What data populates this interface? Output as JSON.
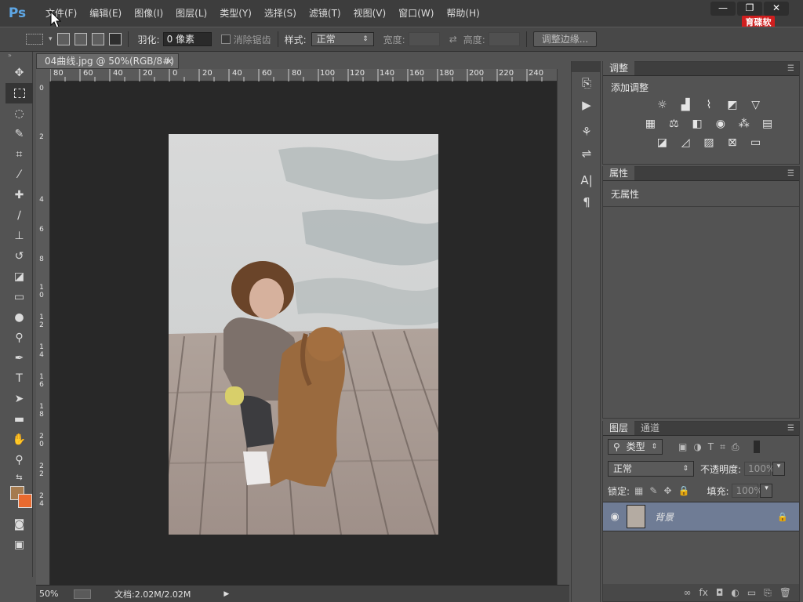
{
  "app": {
    "logo": "Ps",
    "brand": "育碟软件"
  },
  "menubar": {
    "items": [
      "文件(F)",
      "编辑(E)",
      "图像(I)",
      "图层(L)",
      "类型(Y)",
      "选择(S)",
      "滤镜(T)",
      "视图(V)",
      "窗口(W)",
      "帮助(H)"
    ]
  },
  "window_controls": {
    "minimize": "—",
    "restore": "❐",
    "close": "✕"
  },
  "options": {
    "feather_label": "羽化:",
    "feather_value": "0 像素",
    "antialias_label": "消除锯齿",
    "style_label": "样式:",
    "style_value": "正常",
    "width_label": "宽度:",
    "height_label": "高度:",
    "refine_edge": "调整边缘..."
  },
  "document": {
    "tab_title": "04曲线.jpg @ 50%(RGB/8#)",
    "tab_close": "×",
    "ruler_h": [
      "80",
      "60",
      "40",
      "20",
      "0",
      "20",
      "40",
      "60",
      "80",
      "100",
      "120",
      "140",
      "160",
      "180",
      "200",
      "220",
      "240"
    ],
    "ruler_v": [
      "0",
      "2",
      "4",
      "6",
      "8",
      "1\n0",
      "1\n2",
      "1\n4",
      "1\n6",
      "1\n8",
      "2\n0",
      "2\n2",
      "2\n4"
    ]
  },
  "status": {
    "zoom": "50%",
    "doc": "文档:2.02M/2.02M"
  },
  "panels": {
    "adjustments": {
      "tab": "调整",
      "title": "添加调整"
    },
    "properties": {
      "tab": "属性",
      "message": "无属性"
    },
    "layers": {
      "tab": "图层",
      "tab2": "通道",
      "filter_kind": "类型",
      "blend_mode": "正常",
      "opacity_label": "不透明度:",
      "opacity_value": "100%",
      "lock_label": "锁定:",
      "fill_label": "填充:",
      "fill_value": "100%",
      "layer_name": "背景"
    }
  },
  "colors": {
    "foreground": "#a57b4f",
    "background": "#e96a2f",
    "layer_selected": "#6f7c95"
  }
}
